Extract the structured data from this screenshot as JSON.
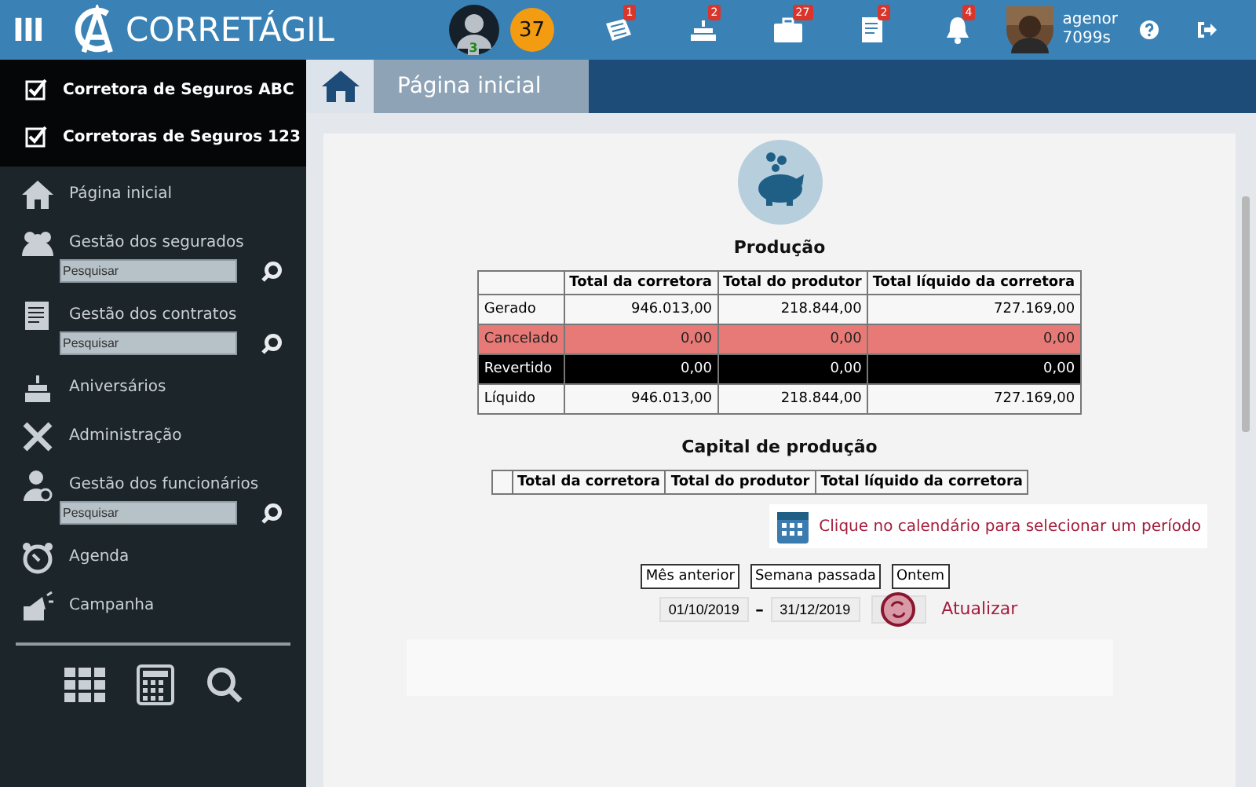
{
  "topbar": {
    "menu_glyph": "III",
    "brand": "CORRETÁGIL",
    "user_count": "3",
    "score": "37",
    "notifications": [
      {
        "kind": "news",
        "count": "1"
      },
      {
        "kind": "cake",
        "count": "2"
      },
      {
        "kind": "briefcase",
        "count": "27"
      },
      {
        "kind": "document",
        "count": "2"
      },
      {
        "kind": "bell",
        "count": "4"
      }
    ],
    "user": {
      "name": "agenor",
      "sub": "7099s"
    }
  },
  "sidebar": {
    "companies": [
      {
        "name": "Corretora de Seguros ABC",
        "checked": true
      },
      {
        "name": "Corretoras de Seguros 123",
        "checked": true
      }
    ],
    "items": [
      {
        "label": "Página inicial"
      },
      {
        "label": "Gestão dos segurados",
        "search_placeholder": "Pesquisar"
      },
      {
        "label": "Gestão dos contratos",
        "search_placeholder": "Pesquisar"
      },
      {
        "label": "Aniversários"
      },
      {
        "label": "Administração"
      },
      {
        "label": "Gestão dos funcionários",
        "search_placeholder": "Pesquisar"
      },
      {
        "label": "Agenda"
      },
      {
        "label": "Campanha"
      }
    ]
  },
  "breadcrumb": {
    "title": "Página inicial"
  },
  "production": {
    "title": "Produção",
    "columns": [
      "Total da corretora",
      "Total do produtor",
      "Total líquido da corretora"
    ],
    "rows": [
      {
        "kind": "normal",
        "label": "Gerado",
        "values": [
          "946.013,00",
          "218.844,00",
          "727.169,00"
        ]
      },
      {
        "kind": "cancelled",
        "label": "Cancelado",
        "values": [
          "0,00",
          "0,00",
          "0,00"
        ]
      },
      {
        "kind": "reverted",
        "label": "Revertido",
        "values": [
          "0,00",
          "0,00",
          "0,00"
        ]
      },
      {
        "kind": "normal",
        "label": "Líquido",
        "values": [
          "946.013,00",
          "218.844,00",
          "727.169,00"
        ]
      }
    ]
  },
  "capital": {
    "title": "Capital de produção",
    "columns": [
      "Total da corretora",
      "Total do produtor",
      "Total líquido da corretora"
    ]
  },
  "period": {
    "hint": "Clique no calendário para selecionar um período",
    "presets": [
      "Mês anterior",
      "Semana passada",
      "Ontem"
    ],
    "from": "01/10/2019",
    "separator": "-",
    "to": "31/12/2019",
    "refresh_label": "Atualizar"
  }
}
